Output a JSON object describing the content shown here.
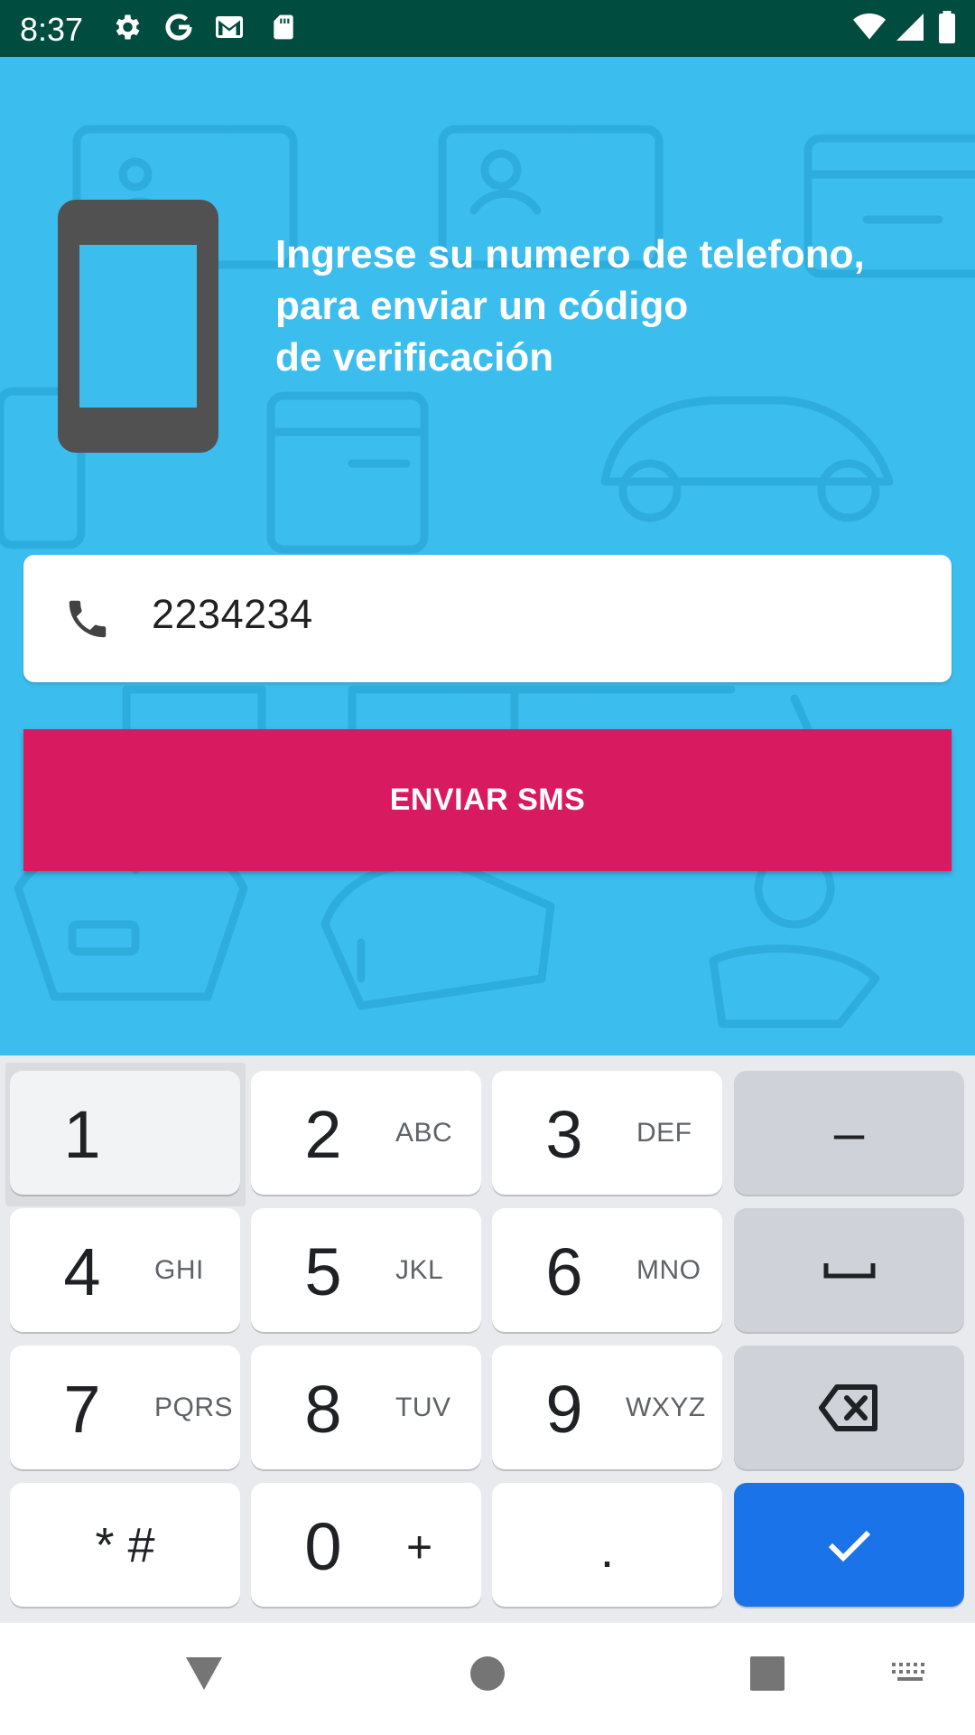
{
  "status_bar": {
    "time": "8:37",
    "left_icons": [
      "settings-icon",
      "google-icon",
      "gmail-icon",
      "sd-card-icon"
    ],
    "right_icons": [
      "wifi-icon",
      "signal-icon",
      "battery-icon"
    ],
    "background_color": "#004d40"
  },
  "main": {
    "background_color": "#3bbdee",
    "instructions": [
      "Ingrese su numero de telefono,",
      "para enviar un código",
      "de verificación"
    ],
    "phone_input": {
      "icon": "phone-icon",
      "value": "2234234"
    },
    "send_button": {
      "label": "ENVIAR SMS",
      "color": "#d81b60"
    }
  },
  "keyboard": {
    "keys": [
      {
        "digit": "1",
        "letters": ""
      },
      {
        "digit": "2",
        "letters": "ABC"
      },
      {
        "digit": "3",
        "letters": "DEF"
      },
      {
        "digit": "4",
        "letters": "GHI"
      },
      {
        "digit": "5",
        "letters": "JKL"
      },
      {
        "digit": "6",
        "letters": "MNO"
      },
      {
        "digit": "7",
        "letters": "PQRS"
      },
      {
        "digit": "8",
        "letters": "TUV"
      },
      {
        "digit": "9",
        "letters": "WXYZ"
      },
      {
        "digit": "0",
        "letters": "+"
      }
    ],
    "minus_key": "–",
    "star_hash_key": "* #",
    "period_key": ".",
    "space_icon": "space-icon",
    "backspace_icon": "backspace-icon",
    "enter_icon": "checkmark-icon",
    "enter_color": "#1a73e8"
  },
  "nav_bar": {
    "icons": [
      "back-icon",
      "home-icon",
      "recents-icon",
      "keyboard-switch-icon"
    ]
  }
}
